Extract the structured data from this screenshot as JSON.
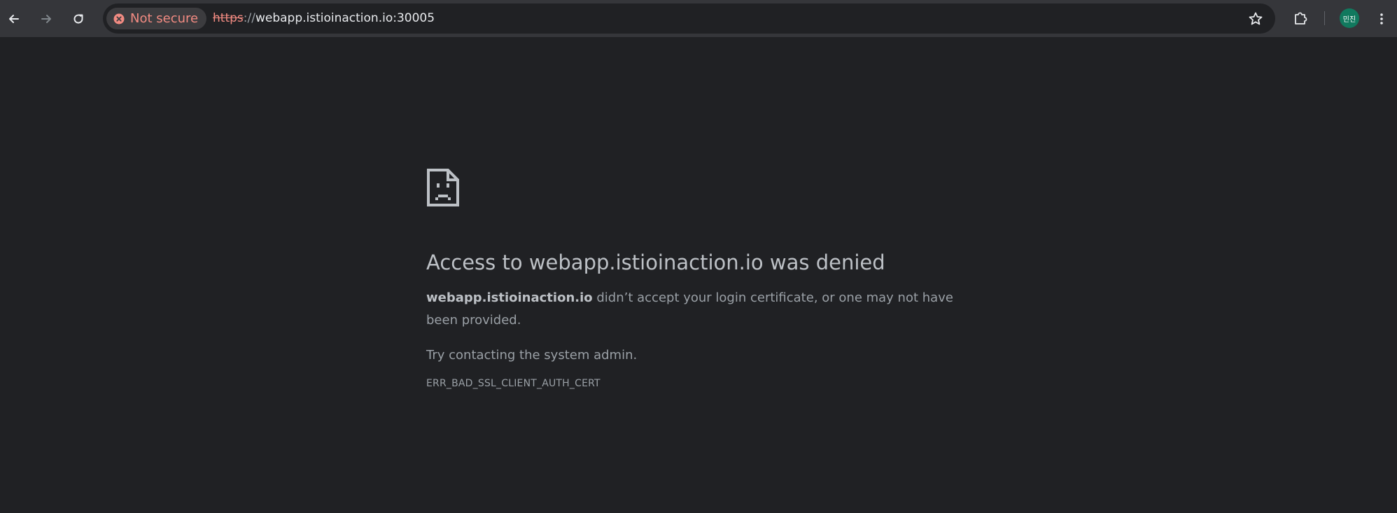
{
  "toolbar": {
    "back_icon": "arrow-left-icon",
    "forward_icon": "arrow-right-icon",
    "reload_icon": "reload-icon",
    "security_label": "Not secure",
    "security_icon": "error-circle-icon",
    "url_scheme": "https",
    "url_separator": "://",
    "url_host": "webapp.istioinaction.io:30005",
    "bookmark_icon": "star-icon",
    "extensions_icon": "puzzle-icon",
    "profile_initials": "민진",
    "menu_icon": "kebab-menu-icon"
  },
  "error_page": {
    "icon": "sad-page-icon",
    "heading": "Access to webapp.istioinaction.io was denied",
    "host_bold": "webapp.istioinaction.io",
    "description_rest": " didn’t accept your login certificate, or one may not have been provided.",
    "hint": "Try contacting the system admin.",
    "error_code": "ERR_BAD_SSL_CLIENT_AUTH_CERT"
  },
  "colors": {
    "page_background": "#202124",
    "toolbar_background": "#35363a",
    "warning_red": "#f28b82",
    "avatar_green": "#11795e"
  }
}
